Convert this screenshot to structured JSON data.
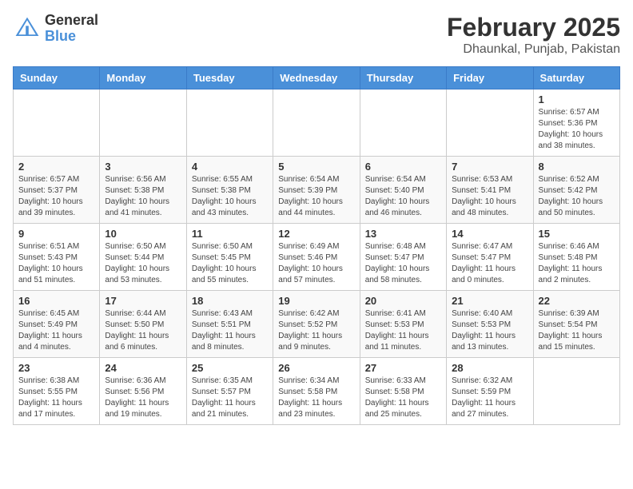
{
  "logo": {
    "general": "General",
    "blue": "Blue"
  },
  "header": {
    "month_year": "February 2025",
    "location": "Dhaunkal, Punjab, Pakistan"
  },
  "days_of_week": [
    "Sunday",
    "Monday",
    "Tuesday",
    "Wednesday",
    "Thursday",
    "Friday",
    "Saturday"
  ],
  "weeks": [
    [
      null,
      null,
      null,
      null,
      null,
      null,
      {
        "day": 1,
        "sunrise": "6:57 AM",
        "sunset": "5:36 PM",
        "daylight": "10 hours and 38 minutes."
      }
    ],
    [
      {
        "day": 2,
        "sunrise": "6:57 AM",
        "sunset": "5:37 PM",
        "daylight": "10 hours and 39 minutes."
      },
      {
        "day": 3,
        "sunrise": "6:56 AM",
        "sunset": "5:38 PM",
        "daylight": "10 hours and 41 minutes."
      },
      {
        "day": 4,
        "sunrise": "6:55 AM",
        "sunset": "5:38 PM",
        "daylight": "10 hours and 43 minutes."
      },
      {
        "day": 5,
        "sunrise": "6:54 AM",
        "sunset": "5:39 PM",
        "daylight": "10 hours and 44 minutes."
      },
      {
        "day": 6,
        "sunrise": "6:54 AM",
        "sunset": "5:40 PM",
        "daylight": "10 hours and 46 minutes."
      },
      {
        "day": 7,
        "sunrise": "6:53 AM",
        "sunset": "5:41 PM",
        "daylight": "10 hours and 48 minutes."
      },
      {
        "day": 8,
        "sunrise": "6:52 AM",
        "sunset": "5:42 PM",
        "daylight": "10 hours and 50 minutes."
      }
    ],
    [
      {
        "day": 9,
        "sunrise": "6:51 AM",
        "sunset": "5:43 PM",
        "daylight": "10 hours and 51 minutes."
      },
      {
        "day": 10,
        "sunrise": "6:50 AM",
        "sunset": "5:44 PM",
        "daylight": "10 hours and 53 minutes."
      },
      {
        "day": 11,
        "sunrise": "6:50 AM",
        "sunset": "5:45 PM",
        "daylight": "10 hours and 55 minutes."
      },
      {
        "day": 12,
        "sunrise": "6:49 AM",
        "sunset": "5:46 PM",
        "daylight": "10 hours and 57 minutes."
      },
      {
        "day": 13,
        "sunrise": "6:48 AM",
        "sunset": "5:47 PM",
        "daylight": "10 hours and 58 minutes."
      },
      {
        "day": 14,
        "sunrise": "6:47 AM",
        "sunset": "5:47 PM",
        "daylight": "11 hours and 0 minutes."
      },
      {
        "day": 15,
        "sunrise": "6:46 AM",
        "sunset": "5:48 PM",
        "daylight": "11 hours and 2 minutes."
      }
    ],
    [
      {
        "day": 16,
        "sunrise": "6:45 AM",
        "sunset": "5:49 PM",
        "daylight": "11 hours and 4 minutes."
      },
      {
        "day": 17,
        "sunrise": "6:44 AM",
        "sunset": "5:50 PM",
        "daylight": "11 hours and 6 minutes."
      },
      {
        "day": 18,
        "sunrise": "6:43 AM",
        "sunset": "5:51 PM",
        "daylight": "11 hours and 8 minutes."
      },
      {
        "day": 19,
        "sunrise": "6:42 AM",
        "sunset": "5:52 PM",
        "daylight": "11 hours and 9 minutes."
      },
      {
        "day": 20,
        "sunrise": "6:41 AM",
        "sunset": "5:53 PM",
        "daylight": "11 hours and 11 minutes."
      },
      {
        "day": 21,
        "sunrise": "6:40 AM",
        "sunset": "5:53 PM",
        "daylight": "11 hours and 13 minutes."
      },
      {
        "day": 22,
        "sunrise": "6:39 AM",
        "sunset": "5:54 PM",
        "daylight": "11 hours and 15 minutes."
      }
    ],
    [
      {
        "day": 23,
        "sunrise": "6:38 AM",
        "sunset": "5:55 PM",
        "daylight": "11 hours and 17 minutes."
      },
      {
        "day": 24,
        "sunrise": "6:36 AM",
        "sunset": "5:56 PM",
        "daylight": "11 hours and 19 minutes."
      },
      {
        "day": 25,
        "sunrise": "6:35 AM",
        "sunset": "5:57 PM",
        "daylight": "11 hours and 21 minutes."
      },
      {
        "day": 26,
        "sunrise": "6:34 AM",
        "sunset": "5:58 PM",
        "daylight": "11 hours and 23 minutes."
      },
      {
        "day": 27,
        "sunrise": "6:33 AM",
        "sunset": "5:58 PM",
        "daylight": "11 hours and 25 minutes."
      },
      {
        "day": 28,
        "sunrise": "6:32 AM",
        "sunset": "5:59 PM",
        "daylight": "11 hours and 27 minutes."
      },
      null
    ]
  ]
}
